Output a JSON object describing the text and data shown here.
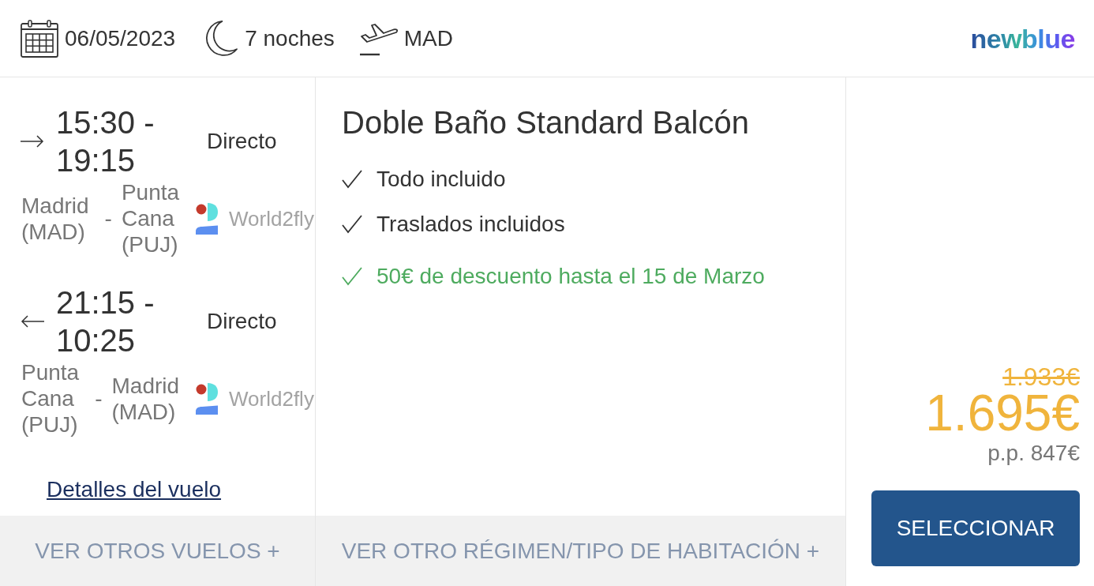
{
  "header": {
    "date": "06/05/2023",
    "nights": "7 noches",
    "departure": "MAD",
    "logo": "newblue"
  },
  "flights": [
    {
      "kind": "outbound",
      "times": "15:30 - 19:15",
      "stops": "Directo",
      "origin": "Madrid (MAD)",
      "separator": "-",
      "destination": "Punta Cana (PUJ)",
      "airline": "World2fly"
    },
    {
      "kind": "return",
      "times": "21:15 - 10:25",
      "stops": "Directo",
      "origin": "Punta Cana (PUJ)",
      "separator": "-",
      "destination": "Madrid (MAD)",
      "airline": "World2fly"
    }
  ],
  "flight_details_link": "Detalles del vuelo",
  "room": {
    "title": "Doble Baño Standard Balcón",
    "features": [
      {
        "kind": "included",
        "text": "Todo incluido"
      },
      {
        "kind": "included",
        "text": "Traslados incluidos"
      },
      {
        "kind": "promo",
        "text": "50€ de descuento hasta el 15 de Marzo"
      }
    ]
  },
  "price": {
    "original": "1.933€",
    "current": "1.695€",
    "per_person": "p.p. 847€",
    "button": "SELECCIONAR"
  },
  "footer": {
    "more_flights": "VER OTROS VUELOS +",
    "more_rooms": "VER OTRO RÉGIMEN/TIPO DE HABITACIÓN +"
  }
}
